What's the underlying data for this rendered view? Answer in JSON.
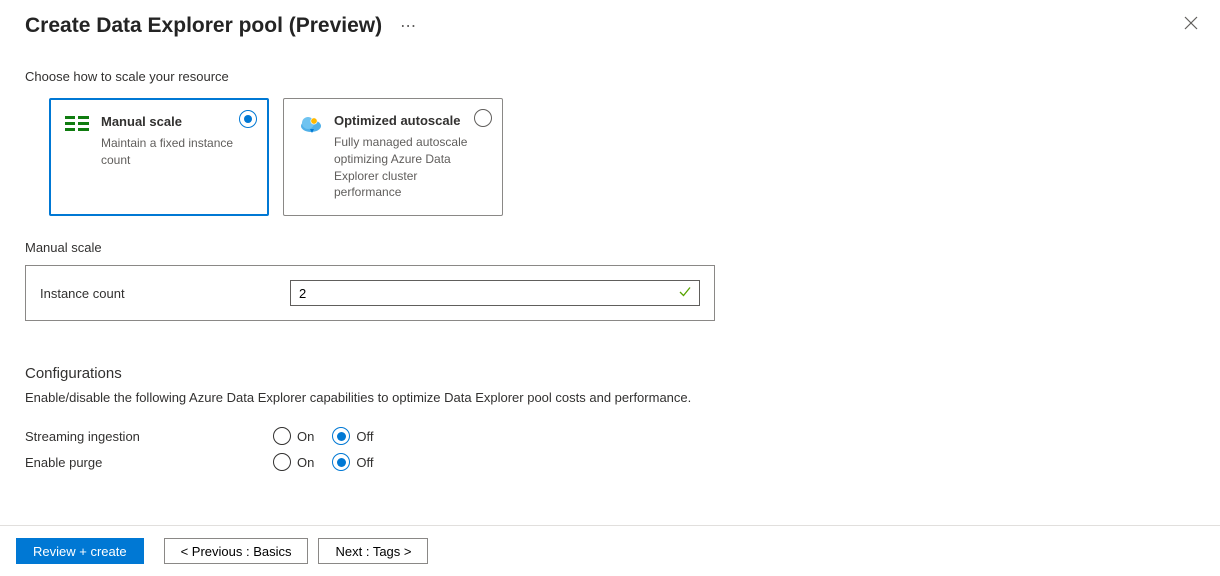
{
  "header": {
    "title": "Create Data Explorer pool (Preview)"
  },
  "scale": {
    "section_label": "Choose how to scale your resource",
    "manual": {
      "title": "Manual scale",
      "desc": "Maintain a fixed instance count"
    },
    "auto": {
      "title": "Optimized autoscale",
      "desc": "Fully managed autoscale optimizing Azure Data Explorer cluster performance"
    },
    "subhead": "Manual scale",
    "instance_count_label": "Instance count",
    "instance_count_value": "2"
  },
  "config": {
    "title": "Configurations",
    "desc": "Enable/disable the following Azure Data Explorer capabilities to optimize Data Explorer pool costs and performance.",
    "streaming_label": "Streaming ingestion",
    "purge_label": "Enable purge",
    "on": "On",
    "off": "Off"
  },
  "footer": {
    "review": "Review + create",
    "prev": "< Previous : Basics",
    "next": "Next : Tags >"
  }
}
